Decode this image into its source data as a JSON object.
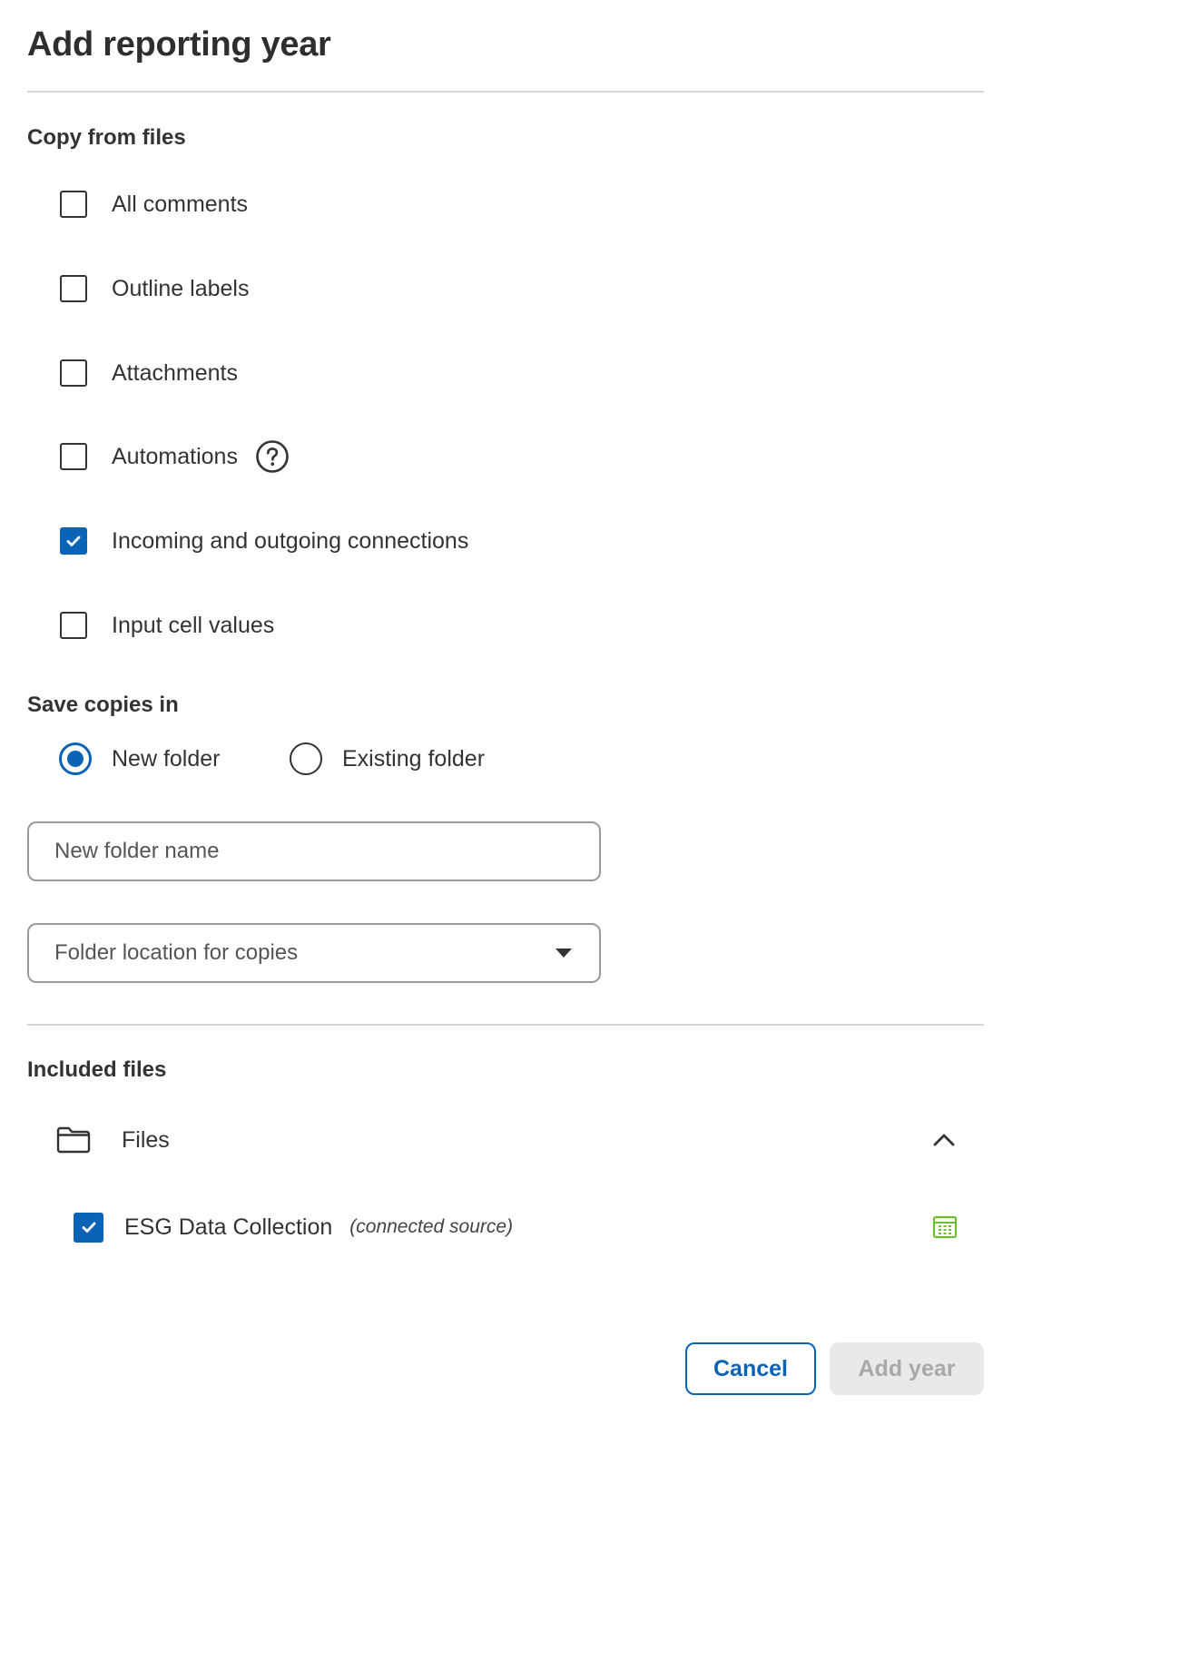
{
  "dialog": {
    "title": "Add reporting year"
  },
  "copy_section": {
    "heading": "Copy from files",
    "options": [
      {
        "label": "All comments",
        "checked": false
      },
      {
        "label": "Outline labels",
        "checked": false
      },
      {
        "label": "Attachments",
        "checked": false
      },
      {
        "label": "Automations",
        "checked": false,
        "help_icon": "question-circle-icon"
      },
      {
        "label": "Incoming and outgoing connections",
        "checked": true
      },
      {
        "label": "Input cell values",
        "checked": false
      }
    ]
  },
  "save_section": {
    "heading": "Save copies in",
    "radios": [
      {
        "label": "New folder",
        "selected": true
      },
      {
        "label": "Existing folder",
        "selected": false
      }
    ],
    "folder_name_input": {
      "placeholder": "New folder name",
      "value": ""
    },
    "location_select": {
      "placeholder": "Folder location for copies",
      "icon": "caret-down-icon"
    }
  },
  "included_section": {
    "heading": "Included files",
    "folder": {
      "label": "Files",
      "icon": "folder-icon",
      "expanded": true,
      "toggle_icon": "chevron-up-icon"
    },
    "files": [
      {
        "name": "ESG Data Collection",
        "note": "(connected source)",
        "checked": true,
        "icon": "spreadsheet-icon"
      }
    ]
  },
  "footer": {
    "cancel_label": "Cancel",
    "submit_label": "Add year"
  },
  "colors": {
    "accent": "#0b63b8",
    "divider": "#d6d6d6",
    "disabled_bg": "#e9e9e9",
    "disabled_text": "#a8a8a8",
    "sheet_icon": "#6cbf2e"
  }
}
